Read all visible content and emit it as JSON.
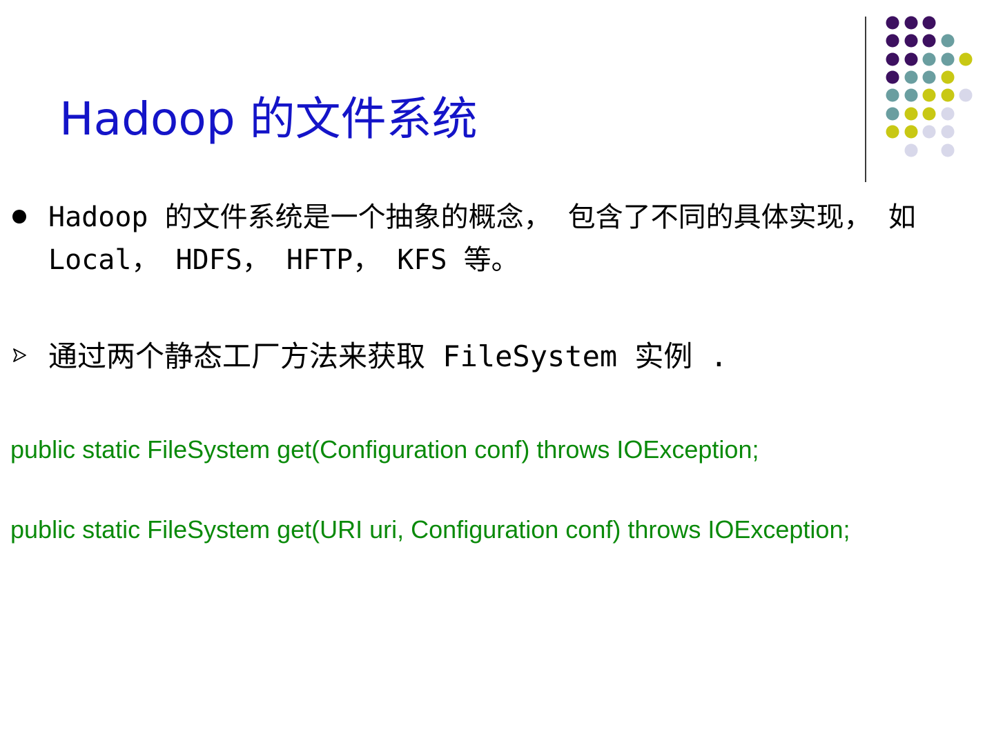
{
  "slide": {
    "title": "Hadoop 的文件系统",
    "bullets": [
      {
        "marker": "dot",
        "text": "Hadoop 的文件系统是一个抽象的概念， 包含了不同的具体实现， 如 Local， HDFS， HFTP， KFS 等。"
      },
      {
        "marker": "arrow",
        "text": "通过两个静态工厂方法来获取 FileSystem 实例 ."
      }
    ],
    "code_lines": [
      "public static FileSystem get(Configuration conf) throws IOException;",
      "public static FileSystem get(URI uri, Configuration conf) throws IOException;"
    ]
  },
  "colors": {
    "title": "#1414c8",
    "body_text": "#000000",
    "code_text": "#0a8a0a",
    "divider": "#3a3a3a",
    "dot_purple": "#3d1060",
    "dot_teal": "#6a9ea0",
    "dot_yellow": "#c8c814",
    "dot_lavender": "#d8d8ea"
  },
  "decoration": {
    "icon": "dot-grid-decoration"
  }
}
